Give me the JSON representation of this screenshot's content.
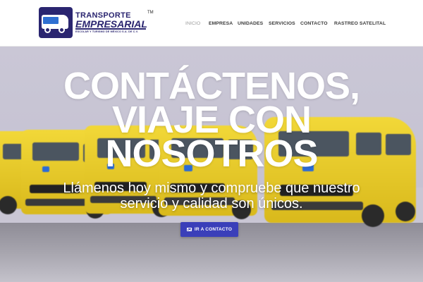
{
  "brand": {
    "line1": "TRANSPORTE",
    "line2": "EMPRESARIAL",
    "line3": "ESCOLAR Y TURISMO DE MÉXICO S.A. DE C.V.",
    "tm": "TM",
    "color": "#2a2570"
  },
  "nav": {
    "items": [
      {
        "label": "INICIO",
        "active": true
      },
      {
        "label": "EMPRESA",
        "active": false
      },
      {
        "label": "UNIDADES",
        "active": false
      },
      {
        "label": "SERVICIOS",
        "active": false
      },
      {
        "label": "CONTACTO",
        "active": false
      },
      {
        "label": "RASTREO SATELITAL",
        "active": false
      }
    ]
  },
  "hero": {
    "title_line1": "CONTÁCTENOS,",
    "title_line2": "VIAJE CON",
    "title_line3": "NOSOTROS",
    "subtitle_line1": "Llámenos hoy mismo y compruebe que nuestro",
    "subtitle_line2": "servicio y calidad son únicos.",
    "cta_label": "IR A CONTACTO",
    "cta_icon": "mail-icon",
    "cta_color": "#3a3fb9",
    "background_tint": "#c9c6d4",
    "van_color": "#f2d838"
  }
}
